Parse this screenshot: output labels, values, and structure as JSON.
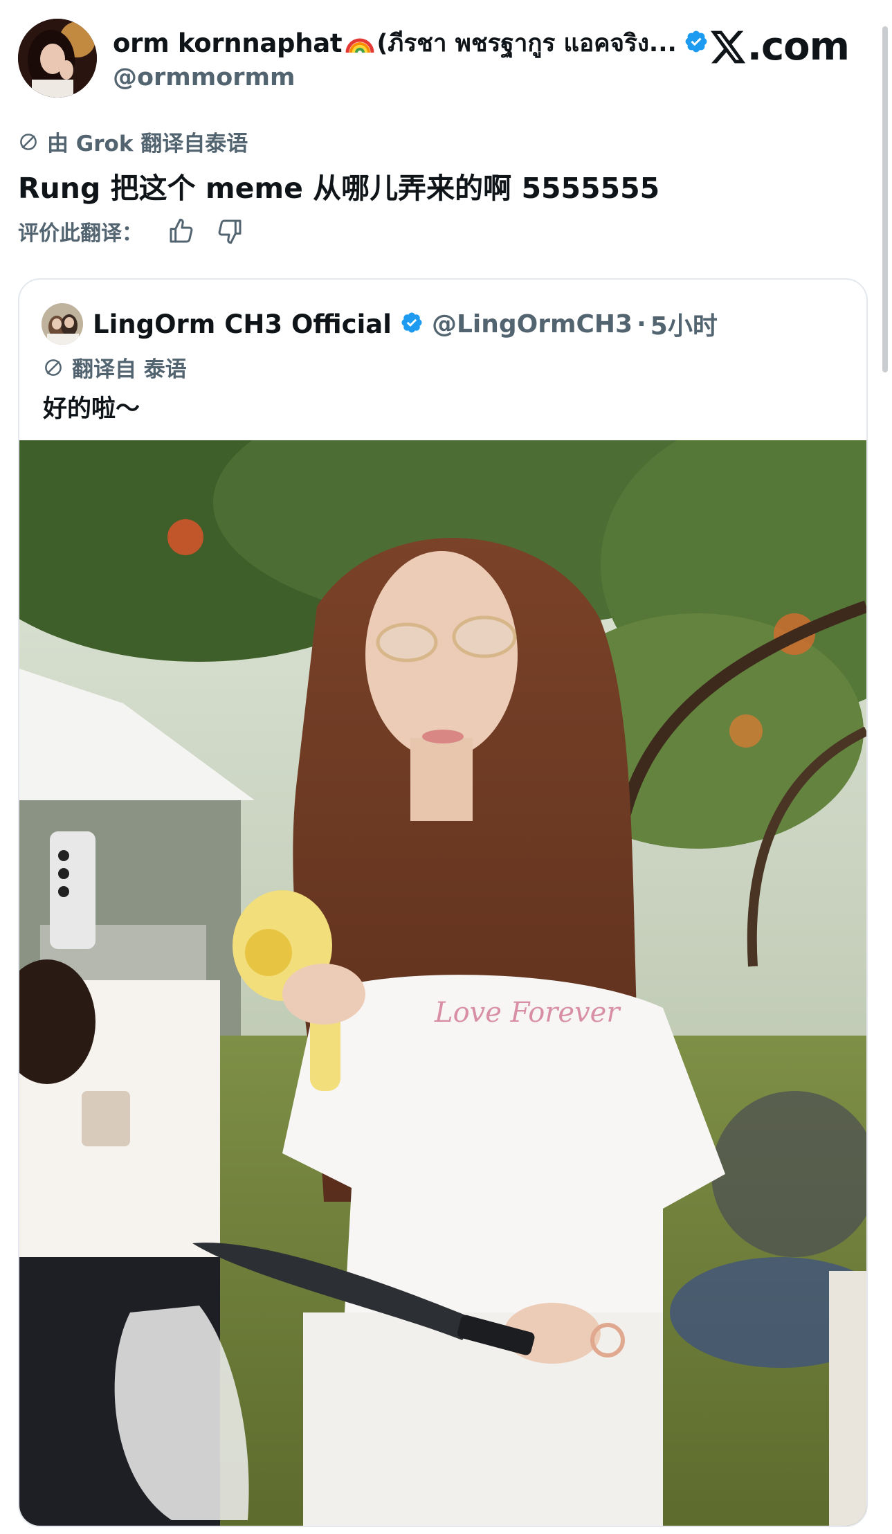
{
  "tweet": {
    "author": {
      "display_name": "orm kornnaphat",
      "name_emoji": "🌈",
      "thai_name": "(ภีรชา พชรฐากูร แอคจริง...",
      "handle": "@ormmormm",
      "verified": true
    },
    "site": "X.com",
    "translation_note": "由 Grok 翻译自泰语",
    "text": "Rung 把这个 meme 从哪儿弄来的啊 5555555",
    "rate_label": "评价此翻译："
  },
  "quote": {
    "author": {
      "display_name": "LingOrm CH3 Official",
      "handle": "@LingOrmCH3",
      "separator": "·",
      "time": "5小时",
      "verified": true
    },
    "translation_note": "翻译自 泰语",
    "text": "好的啦～"
  },
  "colors": {
    "verified_blue": "#1d9bf0",
    "secondary_text": "#536471",
    "primary_text": "#0f1419",
    "card_border": "#e4e8ec"
  },
  "icons": [
    "translate-icon",
    "verified-badge-icon",
    "thumbs-up-icon",
    "thumbs-down-icon",
    "x-logo-icon"
  ]
}
